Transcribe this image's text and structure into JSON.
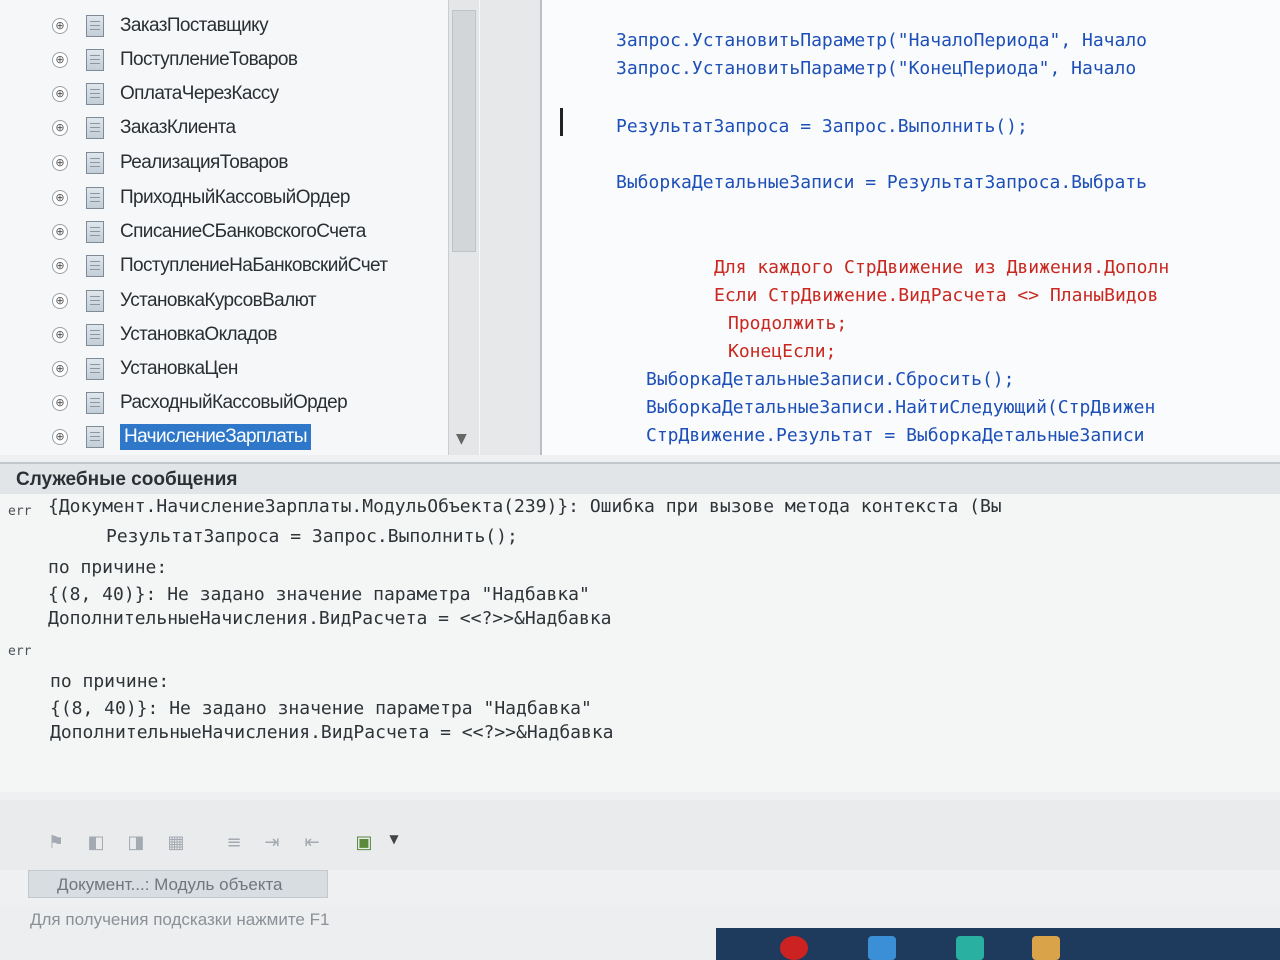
{
  "tree": {
    "items": [
      {
        "label": "ЗаказПоставщику"
      },
      {
        "label": "ПоступлениеТоваров"
      },
      {
        "label": "ОплатаЧерезКассу"
      },
      {
        "label": "ЗаказКлиента"
      },
      {
        "label": "РеализацияТоваров"
      },
      {
        "label": "ПриходныйКассовыйОрдер"
      },
      {
        "label": "СписаниеСБанковскогоСчета"
      },
      {
        "label": "ПоступлениеНаБанковскийСчет"
      },
      {
        "label": "УстановкаКурсовВалют"
      },
      {
        "label": "УстановкаОкладов"
      },
      {
        "label": "УстановкаЦен"
      },
      {
        "label": "РасходныйКассовыйОрдер"
      },
      {
        "label": "НачислениеЗарплаты",
        "selected": true
      }
    ],
    "expander_glyph": "⊕"
  },
  "editor": {
    "lines": [
      "Запрос.УстановитьПараметр(\"НачалоПериода\", Начало",
      "Запрос.УстановитьПараметр(\"КонецПериода\", Начало",
      "РезультатЗапроса = Запрос.Выполнить();",
      "ВыборкаДетальныеЗаписи = РезультатЗапроса.Выбрать",
      "Для каждого СтрДвижение из Движения.Дополн",
      "Если СтрДвижение.ВидРасчета <> ПланыВидов",
      "Продолжить;",
      "КонецЕсли;",
      "ВыборкаДетальныеЗаписи.Сбросить();",
      "ВыборкаДетальныеЗаписи.НайтиСледующий(СтрДвижен",
      "СтрДвижение.Результат = ВыборкаДетальныеЗаписи"
    ]
  },
  "messages": {
    "title": "Служебные сообщения",
    "err_tag": "err",
    "lines": [
      "{Документ.НачислениеЗарплаты.МодульОбъекта(239)}: Ошибка при вызове метода контекста (Вы",
      "РезультатЗапроса = Запрос.Выполнить();",
      "по причине:",
      "{(8, 40)}: Не задано значение параметра \"Надбавка\"",
      "ДополнительныеНачисления.ВидРасчета = <<?>>&Надбавка",
      "по причине:",
      "{(8, 40)}: Не задано значение параметра \"Надбавка\"",
      "ДополнительныеНачисления.ВидРасчета = <<?>>&Надбавка"
    ]
  },
  "toolbar": {
    "icons": [
      "flag-icon",
      "bookmark-prev-icon",
      "bookmark-next-icon",
      "bookmark-clear-icon",
      "indent-icon",
      "indent-more-icon",
      "indent-less-icon",
      "insert-icon"
    ]
  },
  "window_tab": {
    "label": "Документ...: Модуль объекта"
  },
  "statusbar": {
    "hint": "Для получения подсказки нажмите F1"
  },
  "colors": {
    "code_blue": "#1d4fb8",
    "code_red": "#c8281f",
    "selection": "#2f78c9"
  }
}
